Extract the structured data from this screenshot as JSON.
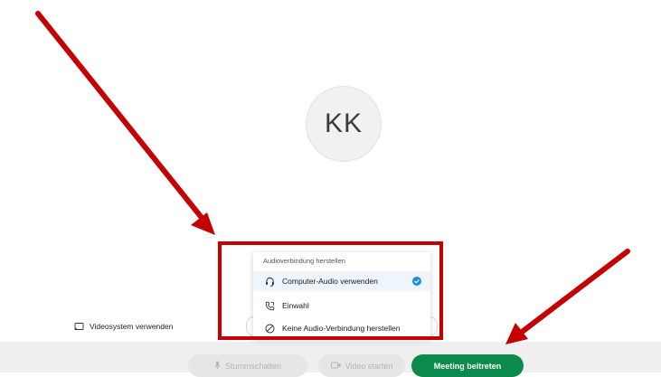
{
  "avatar": {
    "initials": "KK"
  },
  "audio_menu": {
    "header": "Audioverbindung herstellen",
    "items": [
      {
        "label": "Computer-Audio verwenden",
        "icon": "headset-icon",
        "selected": true
      },
      {
        "label": "Einwahl",
        "icon": "phone-icon",
        "selected": false
      },
      {
        "label": "Keine Audio-Verbindung herstellen",
        "icon": "no-audio-icon",
        "selected": false
      }
    ]
  },
  "video_system": {
    "label": "Videosystem verwenden",
    "icon": "cast-icon"
  },
  "toolbar": {
    "mute_label": "Stummschalten",
    "video_label": "Video starten",
    "join_label": "Meeting beitreten"
  },
  "colors": {
    "join": "#0b8a4c",
    "annotation": "#c40000",
    "selected_bg": "#eef6fc",
    "check": "#1a8fe0"
  }
}
